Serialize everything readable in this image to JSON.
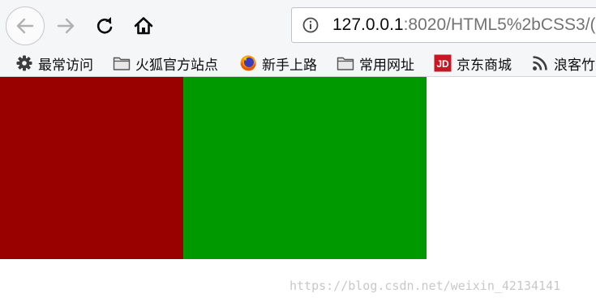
{
  "url": {
    "host": "127.0.0.1",
    "rest": ":8020/HTML5%2bCSS3/(",
    "info_icon": "info-icon"
  },
  "bookmarks": [
    {
      "label": "最常访问",
      "icon": "gear-icon"
    },
    {
      "label": "火狐官方站点",
      "icon": "folder-icon"
    },
    {
      "label": "新手上路",
      "icon": "firefox-icon"
    },
    {
      "label": "常用网址",
      "icon": "folder-icon"
    },
    {
      "label": "京东商城",
      "icon": "jd-icon"
    },
    {
      "label": "浪客竹",
      "icon": "rss-icon"
    }
  ],
  "colors": {
    "red_box": "#990000",
    "green_box": "#009900",
    "jd_brand": "#c81623"
  },
  "watermark": "https://blog.csdn.net/weixin_42134141"
}
